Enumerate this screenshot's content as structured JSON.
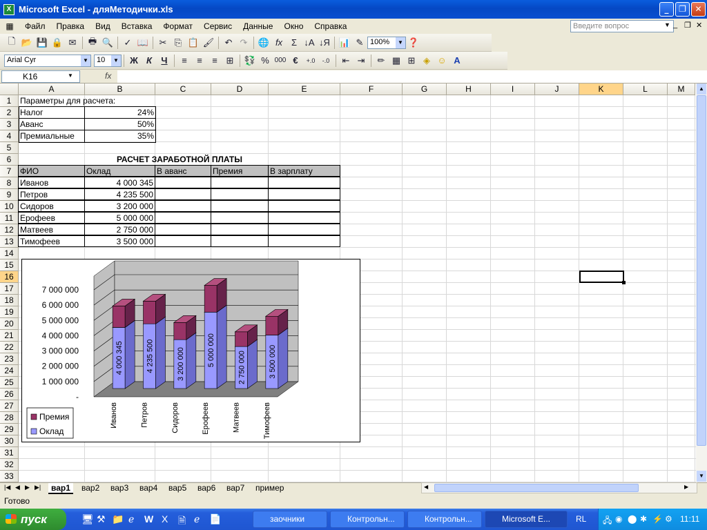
{
  "window": {
    "title": "Microsoft Excel - дляМетодички.xls"
  },
  "menu": [
    "Файл",
    "Правка",
    "Вид",
    "Вставка",
    "Формат",
    "Сервис",
    "Данные",
    "Окно",
    "Справка"
  ],
  "help_placeholder": "Введите вопрос",
  "toolbar": {
    "zoom": "100%",
    "font": "Arial Cyr",
    "size": "10",
    "bold": "Ж",
    "italic": "К",
    "underline": "Ч",
    "percent": "%",
    "thousands": "000",
    "euro": "€"
  },
  "namebox": "K16",
  "fx": "fx",
  "columns": [
    "A",
    "B",
    "C",
    "D",
    "E",
    "F",
    "G",
    "H",
    "I",
    "J",
    "K",
    "L",
    "M"
  ],
  "rows": [
    "1",
    "2",
    "3",
    "4",
    "5",
    "6",
    "7",
    "8",
    "9",
    "10",
    "11",
    "12",
    "13",
    "14",
    "15",
    "16",
    "17",
    "18",
    "19",
    "20",
    "21",
    "22",
    "23",
    "24",
    "25",
    "26",
    "27",
    "28",
    "29",
    "30",
    "31",
    "32",
    "33"
  ],
  "cells": {
    "a1": "Параметры для расчета:",
    "params": [
      {
        "label": "Налог",
        "value": "24%"
      },
      {
        "label": "Аванс",
        "value": "50%"
      },
      {
        "label": "Премиальные",
        "value": "35%"
      }
    ],
    "table_title": "РАСЧЕТ ЗАРАБОТНОЙ ПЛАТЫ",
    "headers": [
      "ФИО",
      "Оклад",
      "В аванс",
      "Премия",
      "В зарплату"
    ],
    "employees": [
      {
        "name": "Иванов",
        "salary": "4 000 345"
      },
      {
        "name": "Петров",
        "salary": "4 235 500"
      },
      {
        "name": "Сидоров",
        "salary": "3 200 000"
      },
      {
        "name": "Ерофеев",
        "salary": "5 000 000"
      },
      {
        "name": "Матвеев",
        "salary": "2 750 000"
      },
      {
        "name": "Тимофеев",
        "salary": "3 500 000"
      }
    ]
  },
  "chart_data": {
    "type": "bar",
    "stacked": true,
    "categories": [
      "Иванов",
      "Петров",
      "Сидоров",
      "Ерофеев",
      "Матвеев",
      "Тимофеев"
    ],
    "series": [
      {
        "name": "Оклад",
        "values": [
          4000345,
          4235500,
          3200000,
          5000000,
          2750000,
          3500000
        ],
        "labels": [
          "4 000 345",
          "4 235 500",
          "3 200 000",
          "5 000 000",
          "2 750 000",
          "3 500 000"
        ],
        "color": "#9999ff"
      },
      {
        "name": "Премия",
        "values": [
          1400121,
          1482425,
          1120000,
          1750000,
          962500,
          1225000
        ],
        "color": "#993366"
      }
    ],
    "yticks": [
      "-",
      "1 000 000",
      "2 000 000",
      "3 000 000",
      "4 000 000",
      "5 000 000",
      "6 000 000",
      "7 000 000"
    ],
    "ylim": [
      0,
      7000000
    ],
    "legend": "left"
  },
  "sheets": [
    "вар1",
    "вар2",
    "вар3",
    "вар4",
    "вар5",
    "вар6",
    "вар7",
    "пример"
  ],
  "active_sheet": "вар1",
  "status": "Готово",
  "taskbar": {
    "start": "пуск",
    "items": [
      "заочники",
      "Контрольн...",
      "Контрольн...",
      "Microsoft E..."
    ],
    "lang": "RL",
    "clock": "11:11"
  }
}
